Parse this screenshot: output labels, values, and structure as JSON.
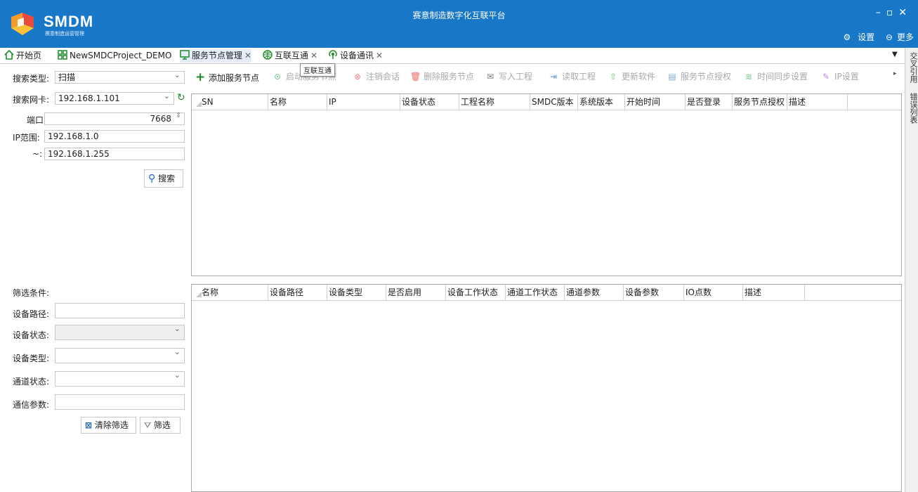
{
  "app": {
    "logo_text": "SMDM",
    "logo_sub": "赛意制造运营管理",
    "title": "赛意制造数字化互联平台",
    "settings_label": "设置",
    "more_label": "更多"
  },
  "tabs": [
    {
      "label": "开始页",
      "icon": "home-icon",
      "closable": false
    },
    {
      "label": "NewSMDCProject_DEMO",
      "icon": "grid-icon",
      "closable": false
    },
    {
      "label": "服务节点管理",
      "icon": "node-icon",
      "closable": true,
      "active": true
    },
    {
      "label": "互联互通",
      "icon": "globe-icon",
      "closable": true
    },
    {
      "label": "设备通讯",
      "icon": "antenna-icon",
      "closable": true
    }
  ],
  "tooltip": "互联互通",
  "right_panel": {
    "cross_ref": "交叉引用",
    "error_list": "错误列表"
  },
  "search": {
    "type_label": "搜索类型:",
    "type_value": "扫描",
    "nic_label": "搜索网卡:",
    "nic_value": "192.168.1.101",
    "port_label": "端口:",
    "port_value": "7668",
    "ip_range_label": "IP范围:",
    "ip_start": "192.168.1.0",
    "ip_end_label": "~:",
    "ip_end": "192.168.1.255",
    "search_button": "搜索"
  },
  "filter": {
    "title": "筛选条件:",
    "device_path_label": "设备路径:",
    "device_status_label": "设备状态:",
    "device_type_label": "设备类型:",
    "channel_status_label": "通道状态:",
    "comm_params_label": "通信参数:",
    "clear_button": "清除筛选",
    "filter_button": "筛选"
  },
  "toolbar": [
    {
      "label": "添加服务节点",
      "icon": "plus-icon",
      "enabled": true
    },
    {
      "label": "启动服务节点",
      "icon": "play-icon",
      "enabled": false
    },
    {
      "label": "注销会话",
      "icon": "cancel-icon",
      "enabled": false
    },
    {
      "label": "删除服务节点",
      "icon": "trash-icon",
      "enabled": false
    },
    {
      "label": "写入工程",
      "icon": "write-icon",
      "enabled": false
    },
    {
      "label": "读取工程",
      "icon": "read-icon",
      "enabled": false
    },
    {
      "label": "更新软件",
      "icon": "upload-icon",
      "enabled": false
    },
    {
      "label": "服务节点授权",
      "icon": "auth-icon",
      "enabled": false
    },
    {
      "label": "时间同步设置",
      "icon": "layers-icon",
      "enabled": false
    },
    {
      "label": "IP设置",
      "icon": "pencil-icon",
      "enabled": false
    }
  ],
  "node_table": {
    "columns": [
      "SN",
      "名称",
      "IP",
      "设备状态",
      "工程名称",
      "SMDC版本",
      "系统版本",
      "开始时间",
      "是否登录",
      "服务节点授权",
      "描述"
    ],
    "rows": []
  },
  "device_table": {
    "columns": [
      "名称",
      "设备路径",
      "设备类型",
      "是否启用",
      "设备工作状态",
      "通道工作状态",
      "通道参数",
      "设备参数",
      "IO点数",
      "描述"
    ],
    "rows": []
  },
  "colors": {
    "titlebar": "#1877c6",
    "accent_green": "#1b8a2a",
    "tab_active": "#e4eef8"
  }
}
